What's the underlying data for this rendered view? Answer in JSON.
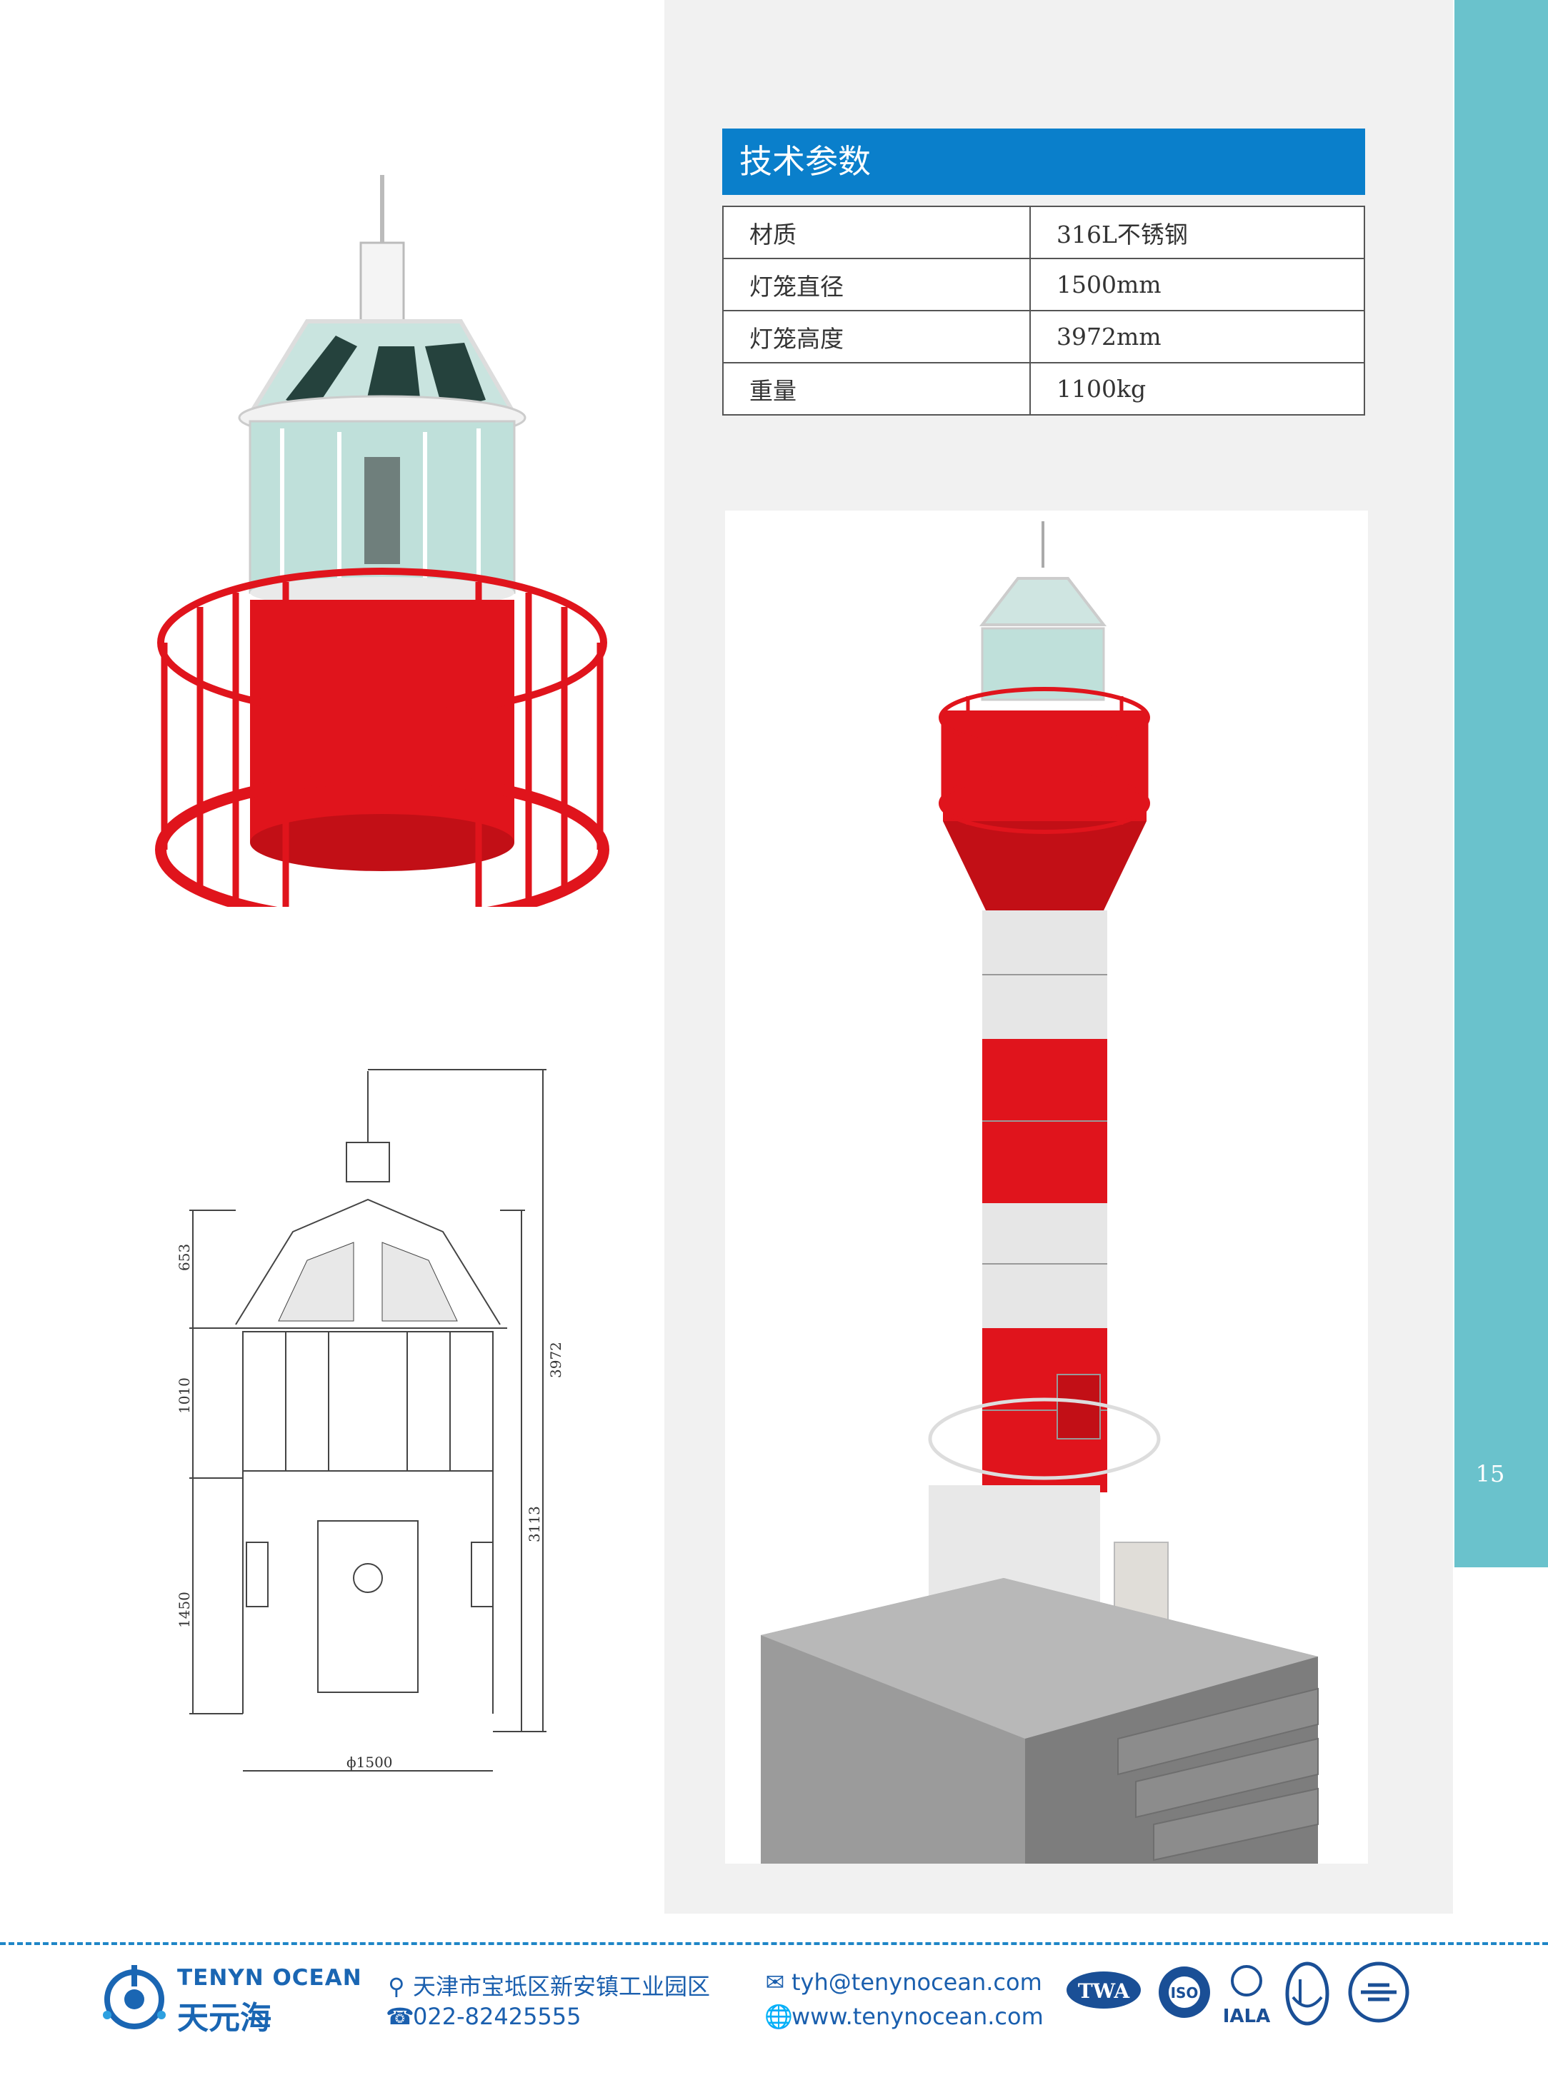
{
  "spec": {
    "title": "技术参数",
    "rows": [
      {
        "label": "材质",
        "value": "316L不锈钢"
      },
      {
        "label": "灯笼直径",
        "value": "1500mm"
      },
      {
        "label": "灯笼高度",
        "value": "3972mm"
      },
      {
        "label": "重量",
        "value": "1100kg"
      }
    ]
  },
  "drawing": {
    "dim_653": "653",
    "dim_1010": "1010",
    "dim_1450": "1450",
    "dim_3972": "3972",
    "dim_3113": "3113",
    "dim_dia": "ϕ1500"
  },
  "page_number": "15",
  "footer": {
    "brand_en": "TENYN OCEAN",
    "brand_cn": "天元海",
    "address": "天津市宝坻区新安镇工业园区",
    "phone": "022-82425555",
    "email": "tyh@tenynocean.com",
    "website": "www.tenynocean.com",
    "badge_twa": "TWA",
    "badge_iso": "ISO",
    "badge_iala": "IALA"
  },
  "colors": {
    "accent_blue": "#0a7fcb",
    "teal": "#6ac2cc",
    "lighthouse_red": "#e0141c"
  }
}
